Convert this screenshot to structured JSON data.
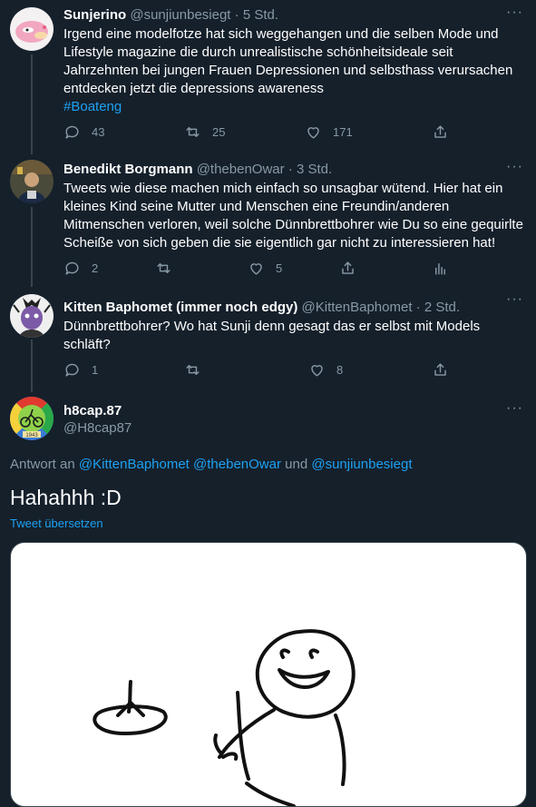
{
  "tweets": [
    {
      "name": "Sunjerino",
      "handle": "@sunjiunbesiegt",
      "time": "· 5 Std.",
      "text": "Irgend eine modelfotze hat sich weggehangen und die selben Mode und Lifestyle magazine die durch unrealistische schönheitsideale seit Jahrzehnten bei jungen Frauen Depressionen und selbsthass verursachen entdecken jetzt die depressions awareness",
      "hashtag": "#Boateng",
      "replies": "43",
      "retweets": "25",
      "likes": "171"
    },
    {
      "name": "Benedikt Borgmann",
      "handle": "@thebenOwar",
      "time": "· 3 Std.",
      "text": "Tweets wie diese machen mich einfach so unsagbar wütend. Hier hat ein kleines Kind seine Mutter und Menschen eine Freundin/anderen Mitmenschen verloren, weil solche Dünnbrettbohrer wie Du so eine gequirlte Scheiße von sich geben die sie eigentlich gar nicht zu interessieren hat!",
      "replies": "2",
      "retweets": "",
      "likes": "5"
    },
    {
      "name": "Kitten Baphomet (immer noch edgy)",
      "handle": "@KittenBaphomet",
      "time": "· 2 Std.",
      "text": "Dünnbrettbohrer? Wo hat Sunji denn gesagt das er selbst mit Models schläft?",
      "replies": "1",
      "retweets": "",
      "likes": "8"
    }
  ],
  "main": {
    "name": "h8cap.87",
    "handle": "@H8cap87",
    "reply_prefix": "Antwort an",
    "reply_handles": [
      "@KittenBaphomet",
      "@thebenOwar",
      "@sunjiunbesiegt"
    ],
    "reply_and": "und",
    "text": "Hahahhh :D",
    "translate": "Tweet übersetzen",
    "avatar_year": "1943"
  },
  "more_label": "···",
  "colors": {
    "background": "#15202b",
    "secondary_text": "#8899a6",
    "link": "#1da1f2",
    "thread_line": "#38444d"
  }
}
